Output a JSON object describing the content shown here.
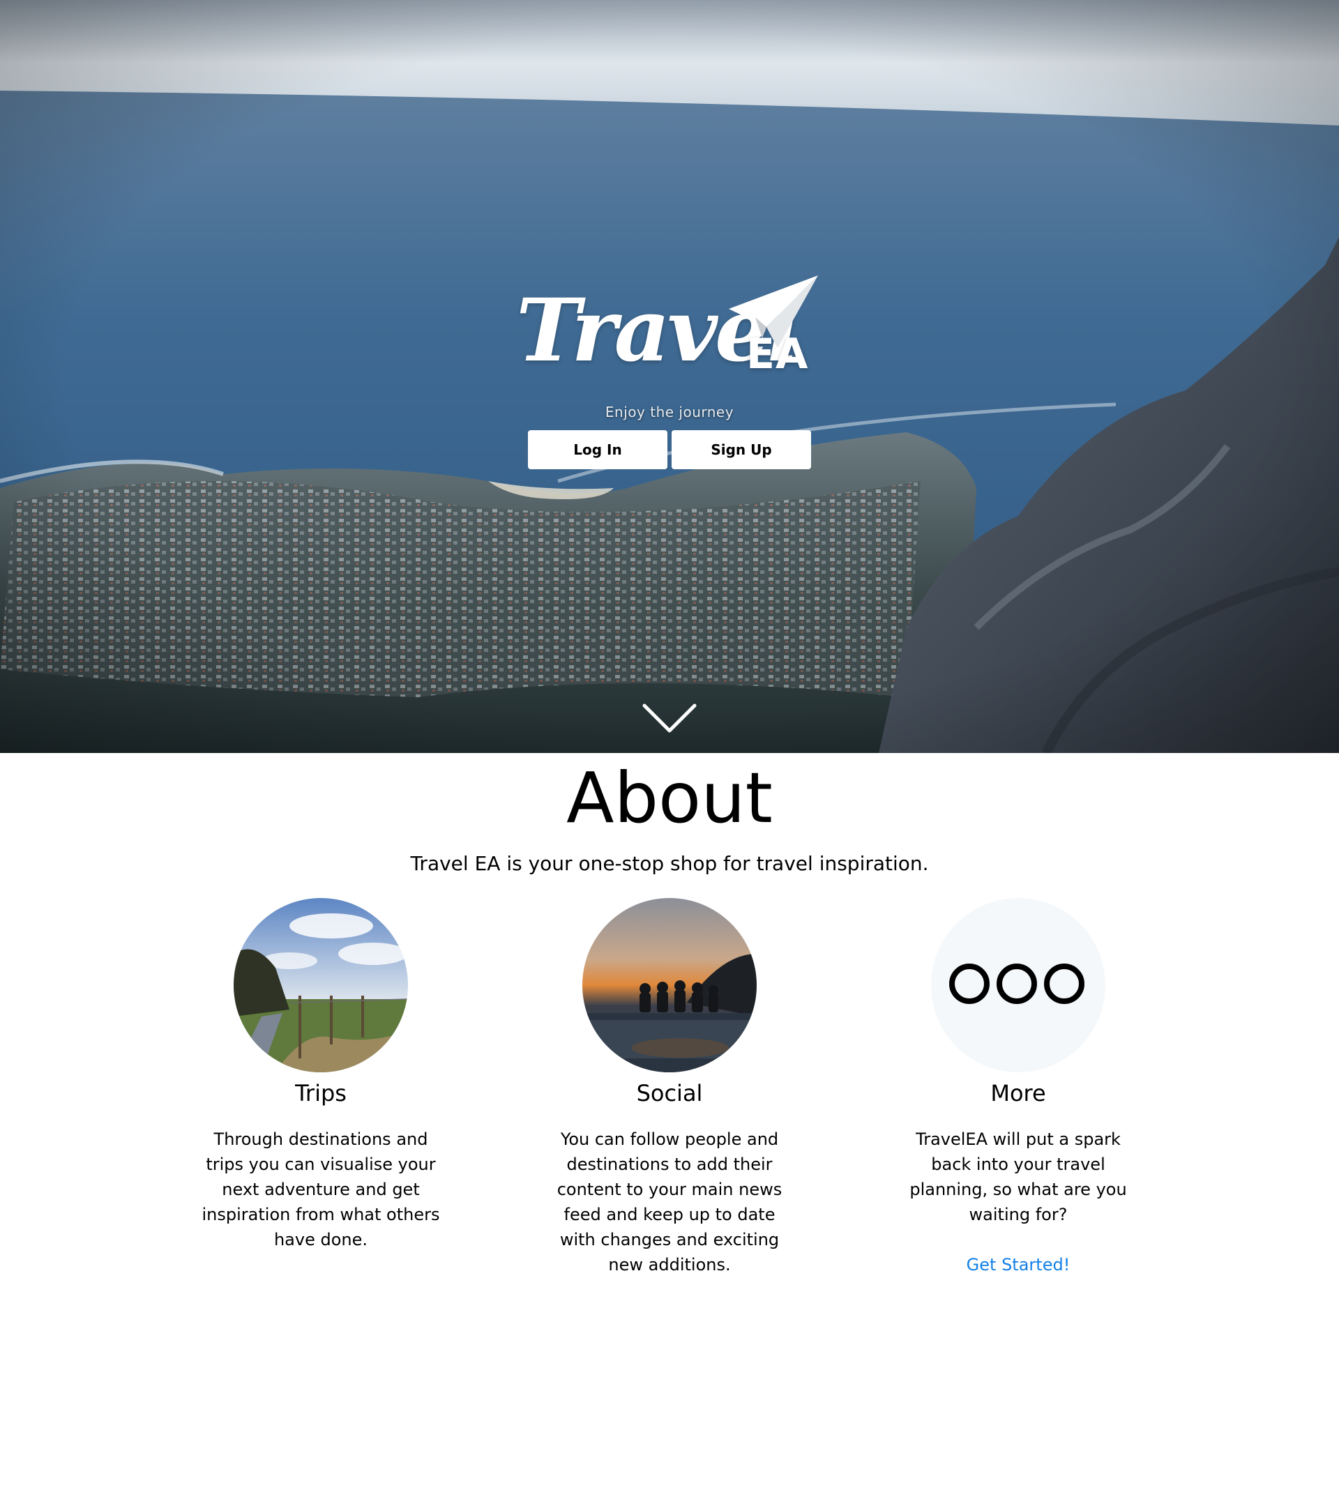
{
  "hero": {
    "logo_text": "Travel",
    "logo_suffix": "EA",
    "tagline": "Enjoy the journey",
    "login_label": "Log In",
    "signup_label": "Sign Up"
  },
  "about": {
    "title": "About",
    "lead": "Travel EA is your one-stop shop for travel inspiration.",
    "features": [
      {
        "title": "Trips",
        "text": "Through destinations and trips you can visualise your next adventure and get inspiration from what others have done."
      },
      {
        "title": "Social",
        "text": "You can follow people and destinations to add their content to your main news feed and keep up to date with changes and exciting new additions."
      },
      {
        "title": "More",
        "text": "TravelEA will put a spark back into your travel planning, so what are you waiting for?",
        "link_label": "Get Started!"
      }
    ]
  },
  "colors": {
    "link": "#1380e6",
    "button_bg": "#ffffff",
    "more_circle_bg": "#f5f8fa"
  },
  "icons": {
    "plane": "paper-plane-icon",
    "chevron": "chevron-down-icon",
    "more": "more-circles-icon"
  }
}
